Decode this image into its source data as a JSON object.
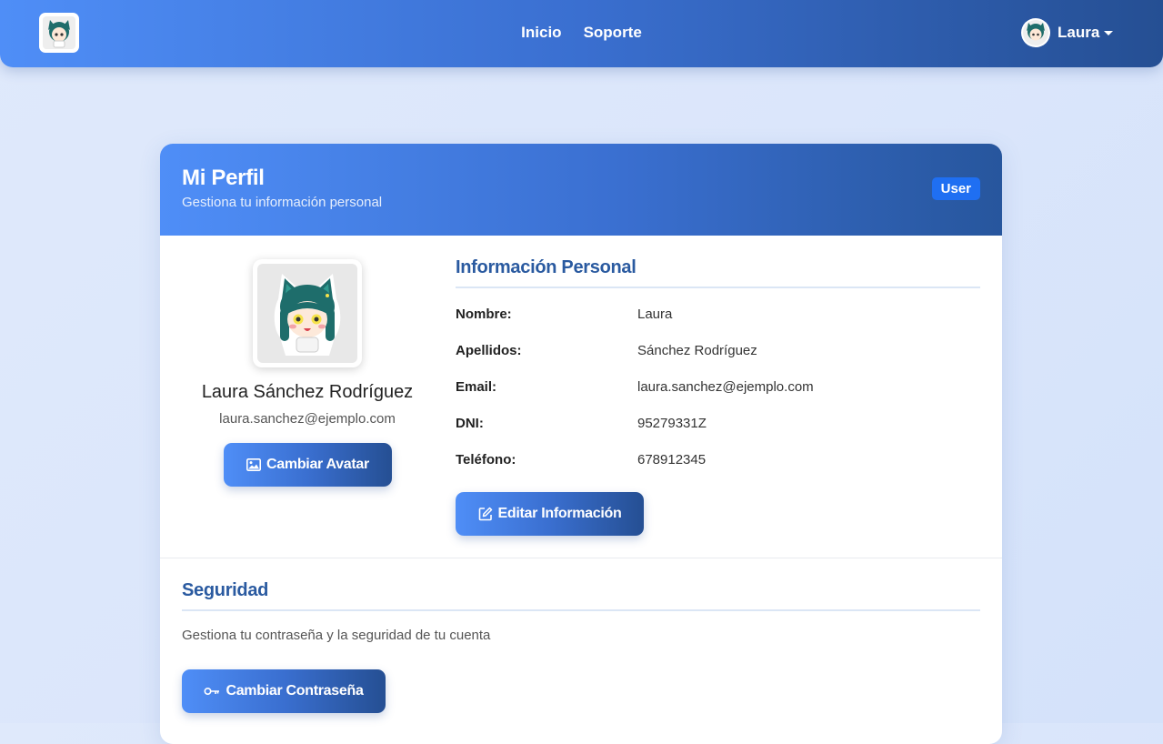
{
  "navbar": {
    "links": [
      "Inicio",
      "Soporte"
    ],
    "user_name": "Laura",
    "brand_icon": "avatar-logo-icon",
    "caret_icon": "caret-down-icon"
  },
  "profile": {
    "title": "Mi Perfil",
    "subtitle": "Gestiona tu información personal",
    "role_badge": "User",
    "full_name": "Laura Sánchez Rodríguez",
    "email": "laura.sanchez@ejemplo.com",
    "change_avatar_label": "Cambiar Avatar",
    "change_avatar_icon": "image-icon"
  },
  "personal_info": {
    "title": "Información Personal",
    "rows": [
      {
        "label": "Nombre:",
        "value": "Laura"
      },
      {
        "label": "Apellidos:",
        "value": "Sánchez Rodríguez"
      },
      {
        "label": "Email:",
        "value": "laura.sanchez@ejemplo.com"
      },
      {
        "label": "DNI:",
        "value": "95279331Z"
      },
      {
        "label": "Teléfono:",
        "value": "678912345"
      }
    ],
    "edit_label": "Editar Información",
    "edit_icon": "edit-icon"
  },
  "security": {
    "title": "Seguridad",
    "description": "Gestiona tu contraseña y la seguridad de tu cuenta",
    "change_password_label": "Cambiar Contraseña",
    "change_password_icon": "key-icon"
  },
  "colors": {
    "primary": "#4f8ef7",
    "primary_dark": "#254f93",
    "badge": "#1f6ff2",
    "section_title": "#2a5aa0"
  }
}
